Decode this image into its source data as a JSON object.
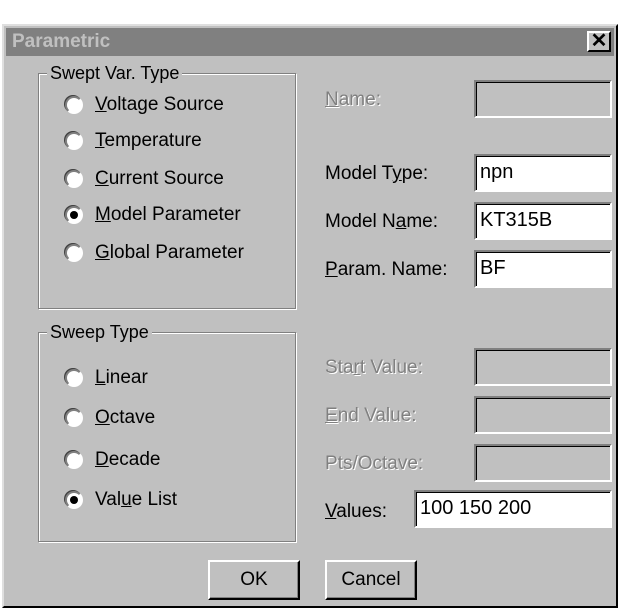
{
  "window": {
    "title": "Parametric",
    "close_glyph": "✕"
  },
  "swept_var_type": {
    "label": "Swept Var. Type",
    "options": [
      {
        "pre": "",
        "key": "V",
        "post": "oltage Source",
        "checked": false
      },
      {
        "pre": "",
        "key": "T",
        "post": "emperature",
        "checked": false
      },
      {
        "pre": "",
        "key": "C",
        "post": "urrent Source",
        "checked": false
      },
      {
        "pre": "",
        "key": "M",
        "post": "odel Parameter",
        "checked": true
      },
      {
        "pre": "",
        "key": "G",
        "post": "lobal Parameter",
        "checked": false
      }
    ]
  },
  "sweep_type": {
    "label": "Sweep Type",
    "options": [
      {
        "pre": "",
        "key": "L",
        "post": "inear",
        "checked": false
      },
      {
        "pre": "",
        "key": "O",
        "post": "ctave",
        "checked": false
      },
      {
        "pre": "",
        "key": "D",
        "post": "ecade",
        "checked": false
      },
      {
        "pre": "Val",
        "key": "u",
        "post": "e List",
        "checked": true
      }
    ]
  },
  "fields": {
    "name": {
      "pre": "",
      "key": "N",
      "post": "ame:",
      "value": ""
    },
    "model_type": {
      "pre": "Model T",
      "key": "y",
      "post": "pe:",
      "value": "npn"
    },
    "model_name": {
      "pre": "Model N",
      "key": "a",
      "post": "me:",
      "value": "KT315B"
    },
    "param_name": {
      "pre": "",
      "key": "P",
      "post": "aram. Name:",
      "value": "BF"
    },
    "start_value": {
      "pre": "Sta",
      "key": "r",
      "post": "t Value:",
      "value": ""
    },
    "end_value": {
      "pre": "",
      "key": "E",
      "post": "nd Value:",
      "value": ""
    },
    "pts_octave": {
      "pre": "Pts/Octave:",
      "key": "",
      "post": "",
      "value": ""
    },
    "values": {
      "pre": "",
      "key": "V",
      "post": "alues:",
      "value": "100 150 200"
    }
  },
  "buttons": {
    "ok": "OK",
    "cancel": "Cancel"
  }
}
